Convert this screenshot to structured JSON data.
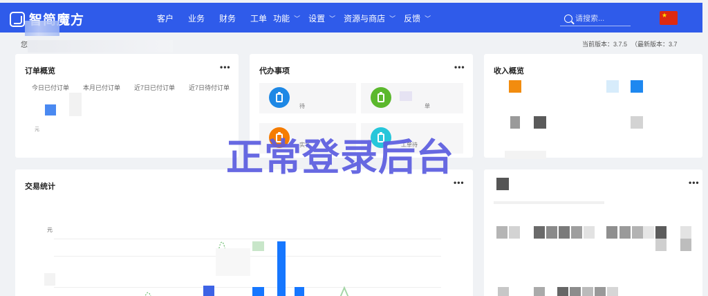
{
  "brand": {
    "name": "智简魔方"
  },
  "nav": {
    "items": [
      {
        "label": "客户",
        "dropdown": false
      },
      {
        "label": "业务",
        "dropdown": false
      },
      {
        "label": "财务",
        "dropdown": false
      },
      {
        "label": "工单",
        "dropdown": false
      },
      {
        "label": "功能",
        "dropdown": true
      },
      {
        "label": "设置",
        "dropdown": true
      },
      {
        "label": "资源与商店",
        "dropdown": true
      },
      {
        "label": "反馈",
        "dropdown": true
      }
    ],
    "search_placeholder": "请搜索...",
    "locale_flag": "china-flag-icon"
  },
  "greeting": "您",
  "version": {
    "current": "当前版本：3.7.5",
    "latest": "（最新版本：3.7"
  },
  "cards": {
    "orders": {
      "title": "订单概览",
      "tabs": [
        "今日已付订单",
        "本月已付订单",
        "近7日已付订单",
        "近7日待付订单"
      ],
      "footnote": "元"
    },
    "todo": {
      "title": "代办事项",
      "tiles": [
        {
          "label": "待",
          "color": "#1e88e5"
        },
        {
          "label": "单",
          "color": "#5bb82d"
        },
        {
          "label": "实名",
          "color": "#f57c00"
        },
        {
          "label": "工单待",
          "color": "#26c6da"
        }
      ]
    },
    "income": {
      "title": "收入概览"
    },
    "trade": {
      "title": "交易统计",
      "unit": "元"
    },
    "panel": {
      "title": ""
    }
  },
  "more_label": "•••",
  "watermark": "正常登录后台",
  "colors": {
    "nav": "#2f5bea",
    "accent": "#1677ff",
    "watermark": "#5b5de0"
  }
}
